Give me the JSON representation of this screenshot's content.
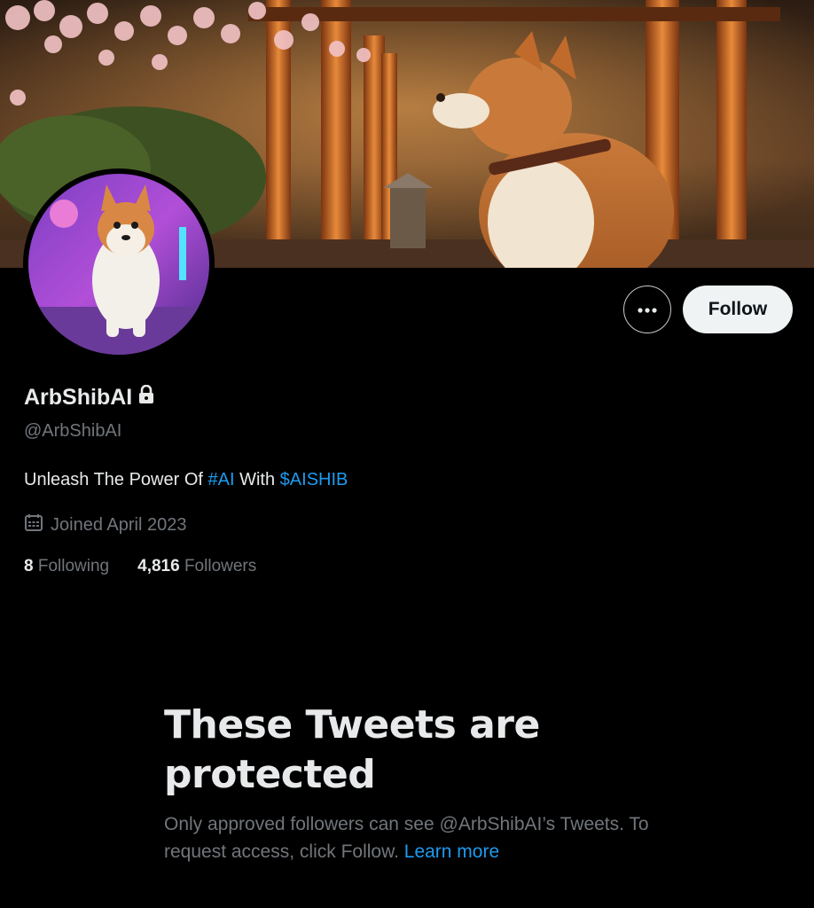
{
  "profile": {
    "display_name": "ArbShibAI",
    "handle": "@ArbShibAI",
    "bio_prefix": "Unleash The Power Of ",
    "bio_hashtag": "#AI",
    "bio_middle": " With ",
    "bio_cashtag": "$AISHIB",
    "joined": "Joined April 2023",
    "following_count": "8",
    "following_label": " Following",
    "followers_count": "4,816",
    "followers_label": " Followers"
  },
  "actions": {
    "more_icon": "more-icon",
    "follow_label": "Follow"
  },
  "protected": {
    "title": "These Tweets are protected",
    "message": "Only approved followers can see @ArbShibAI’s Tweets. To request access, click Follow. ",
    "learn_more": "Learn more"
  },
  "colors": {
    "background": "#000000",
    "text_primary": "#e7e9ea",
    "text_secondary": "#71767b",
    "link": "#1d9bf0",
    "follow_button_bg": "#eff3f4"
  },
  "icons": {
    "lock": "lock-icon",
    "calendar": "calendar-icon"
  }
}
